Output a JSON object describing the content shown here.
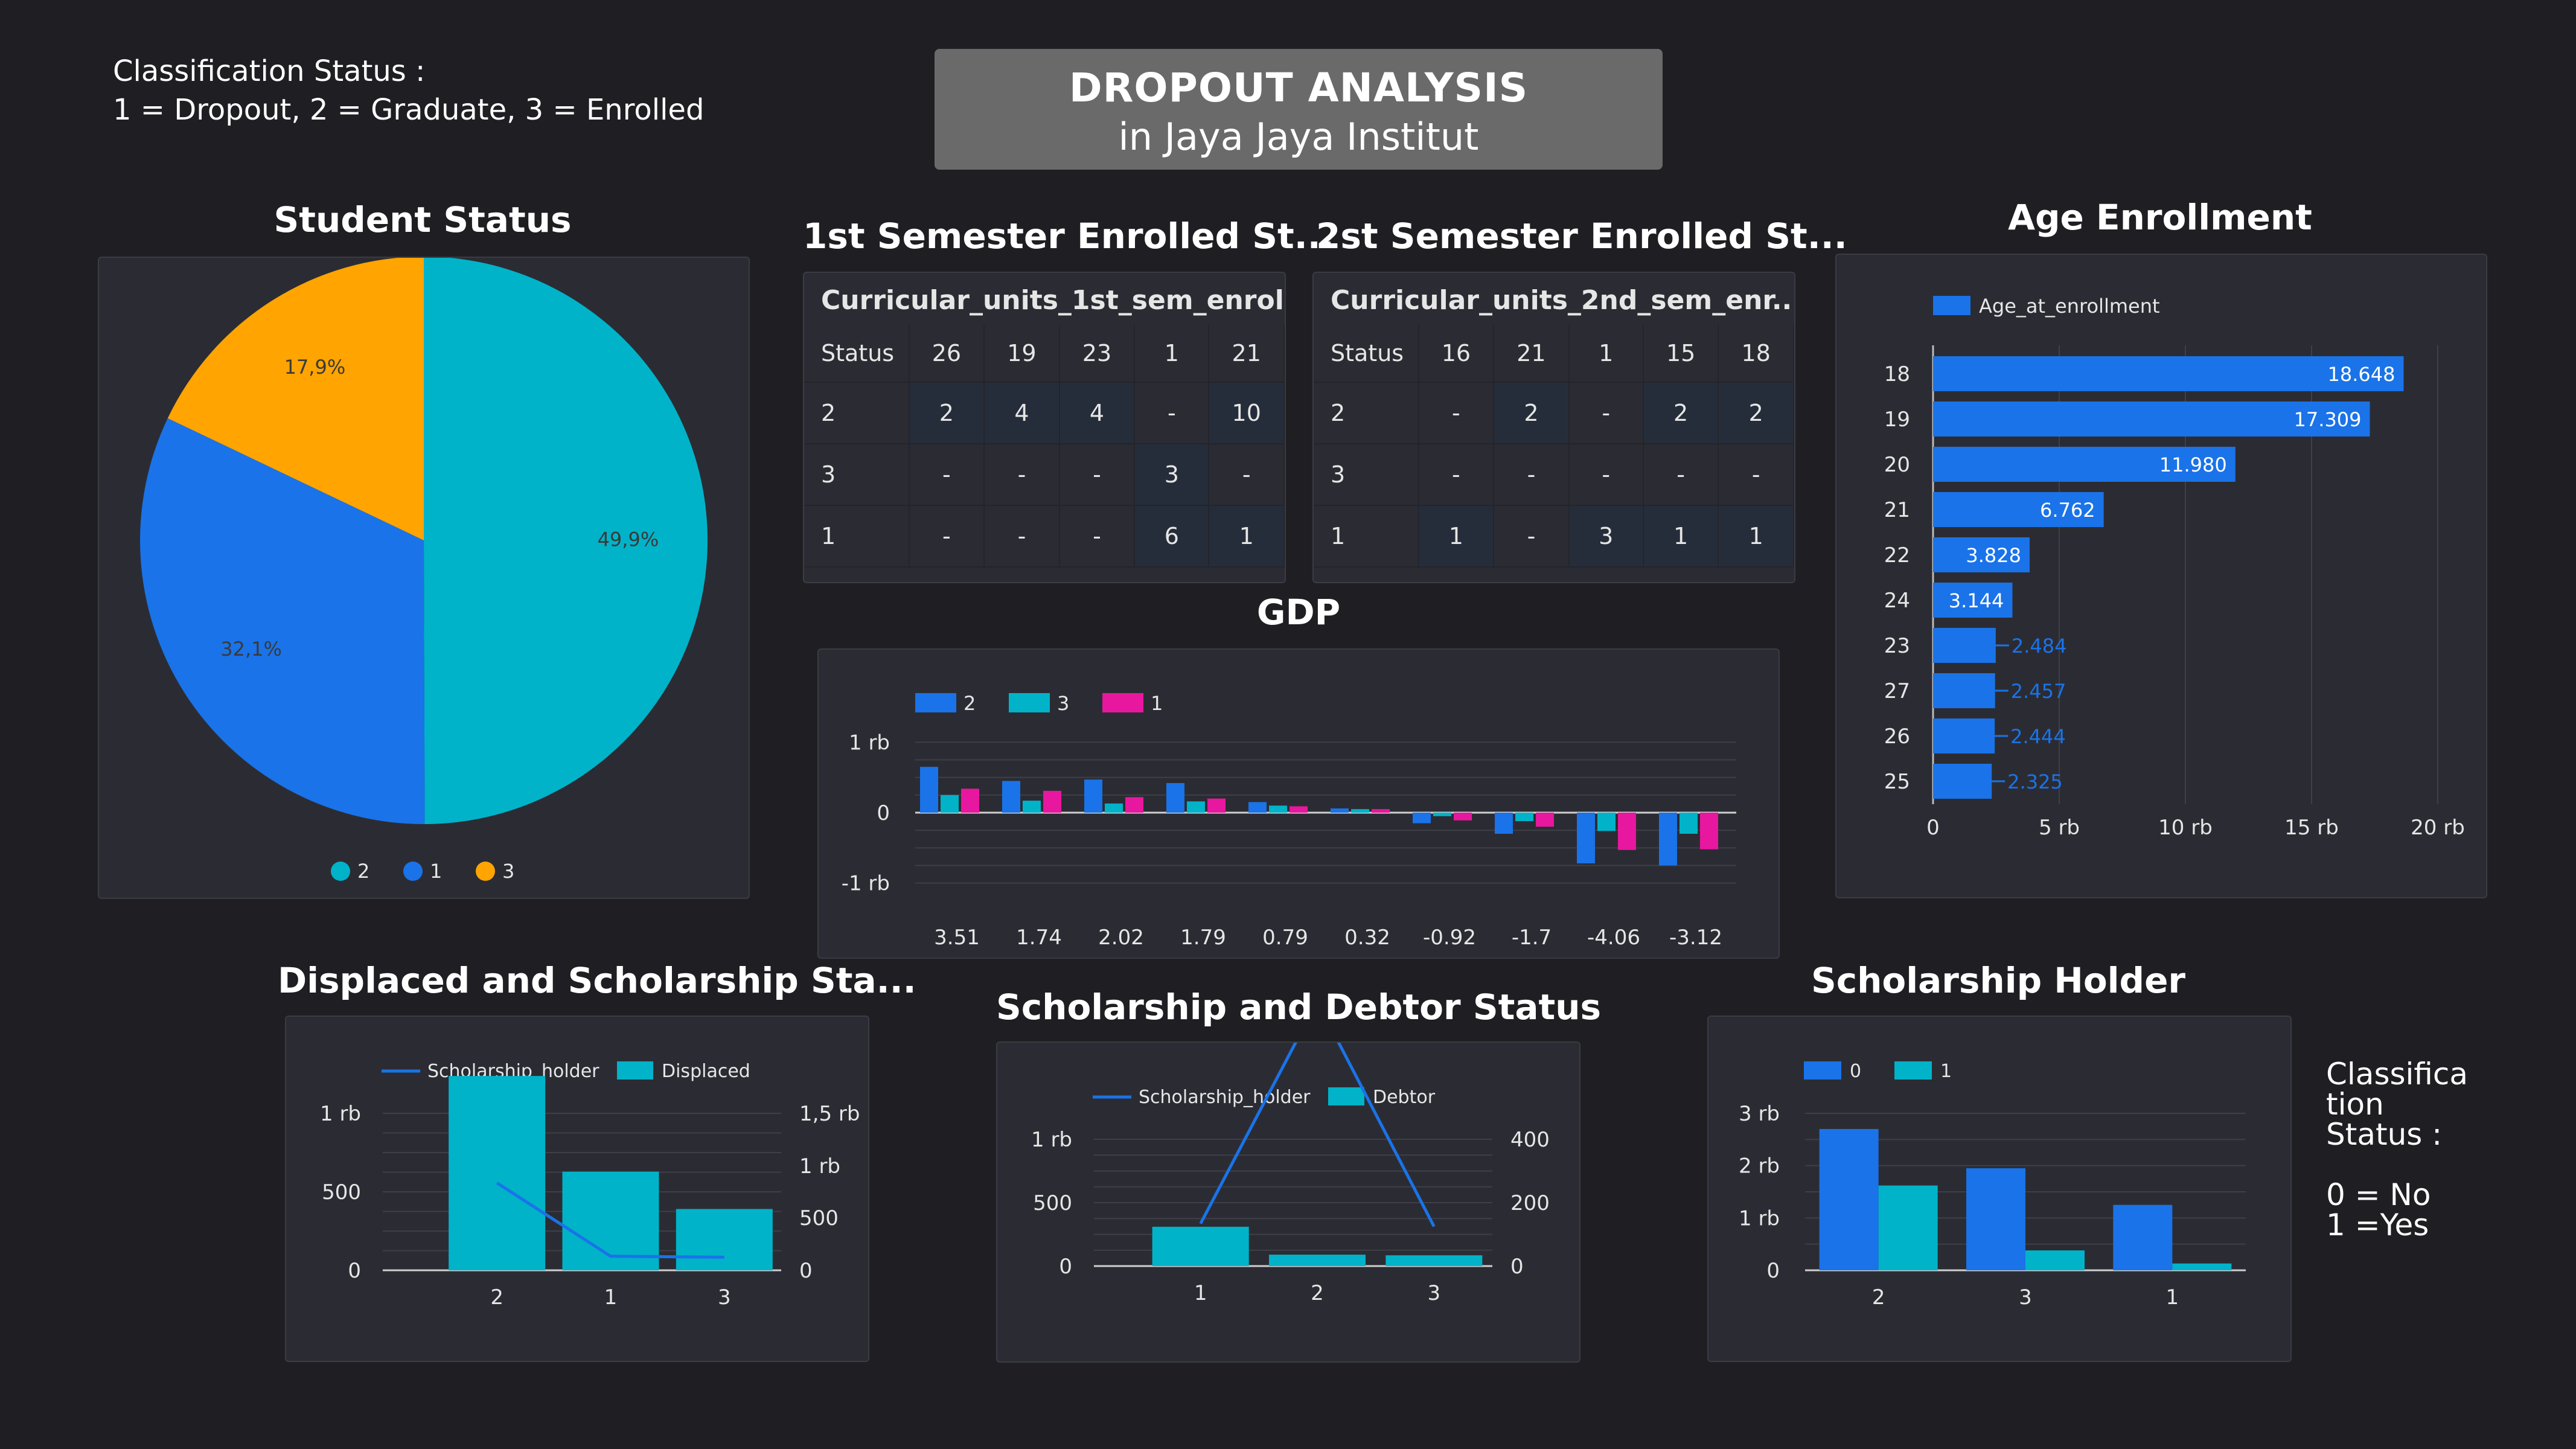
{
  "header": {
    "title": "DROPOUT ANALYSIS",
    "subtitle": "in Jaya Jaya Institut"
  },
  "notes": {
    "classification_top": "Classification Status :\n1 = Dropout, 2 = Graduate, 3 = Enrolled",
    "classification_right": "Classifica\ntion\nStatus :\n\n0 = No\n1 =Yes"
  },
  "titles": {
    "student_status": "Student Status",
    "sem1": "1st Semester Enrolled St...",
    "sem2": "2st Semester Enrolled St...",
    "age": "Age Enrollment",
    "gdp": "GDP",
    "displaced": "Displaced and Scholarship Sta...",
    "debtor": "Scholarship and Debtor Status",
    "holder": "Scholarship Holder"
  },
  "colors": {
    "blue": "#1a73e8",
    "cyan": "#00b3c9",
    "orange": "#ffa400",
    "pink": "#e8179f",
    "bg": "#1f1e22",
    "panel": "#2b2c33"
  },
  "chart_data": [
    {
      "id": "student_status",
      "type": "pie",
      "slices": [
        {
          "name": "2",
          "value": 49.9,
          "label": "49,9%",
          "color": "#00b3c9"
        },
        {
          "name": "1",
          "value": 32.1,
          "label": "32,1%",
          "color": "#1a73e8"
        },
        {
          "name": "3",
          "value": 17.9,
          "label": "17,9%",
          "color": "#ffa400"
        }
      ],
      "legend": [
        "2",
        "1",
        "3"
      ]
    },
    {
      "id": "sem1",
      "type": "table",
      "header_title": "Curricular_units_1st_sem_enrol...",
      "columns": [
        "Status",
        "26",
        "19",
        "23",
        "1",
        "21"
      ],
      "rows": [
        [
          "2",
          "2",
          "4",
          "4",
          "-",
          "10"
        ],
        [
          "3",
          "-",
          "-",
          "-",
          "3",
          "-"
        ],
        [
          "1",
          "-",
          "-",
          "-",
          "6",
          "1"
        ]
      ]
    },
    {
      "id": "sem2",
      "type": "table",
      "header_title": "Curricular_units_2nd_sem_enr...",
      "columns": [
        "Status",
        "16",
        "21",
        "1",
        "15",
        "18"
      ],
      "rows": [
        [
          "2",
          "-",
          "2",
          "-",
          "2",
          "2"
        ],
        [
          "3",
          "-",
          "-",
          "-",
          "-",
          "-"
        ],
        [
          "1",
          "1",
          "-",
          "3",
          "1",
          "1"
        ]
      ]
    },
    {
      "id": "age",
      "type": "bar",
      "orientation": "horizontal",
      "legend": "Age_at_enrollment",
      "categories": [
        "18",
        "19",
        "20",
        "21",
        "22",
        "24",
        "23",
        "27",
        "26",
        "25"
      ],
      "values": [
        18648,
        17309,
        11980,
        6762,
        3828,
        3144,
        2484,
        2457,
        2444,
        2325
      ],
      "value_labels": [
        "18.648",
        "17.309",
        "11.980",
        "6.762",
        "3.828",
        "3.144",
        "2.484",
        "2.457",
        "2.444",
        "2.325"
      ],
      "xticks": [
        "0",
        "5 rb",
        "10 rb",
        "15 rb",
        "20 rb"
      ],
      "xlim": [
        0,
        20000
      ]
    },
    {
      "id": "gdp",
      "type": "bar",
      "categories": [
        "3.51",
        "1.74",
        "2.02",
        "1.79",
        "0.79",
        "0.32",
        "-0.92",
        "-1.7",
        "-4.06",
        "-3.12"
      ],
      "series": [
        {
          "name": "2",
          "color": "#1a73e8",
          "values": [
            650,
            450,
            470,
            420,
            150,
            60,
            -150,
            -300,
            -720,
            -750
          ]
        },
        {
          "name": "3",
          "color": "#00b3c9",
          "values": [
            250,
            170,
            130,
            160,
            100,
            50,
            -50,
            -120,
            -260,
            -300
          ]
        },
        {
          "name": "1",
          "color": "#e8179f",
          "values": [
            340,
            310,
            220,
            200,
            90,
            50,
            -110,
            -200,
            -530,
            -520
          ]
        }
      ],
      "yticks": [
        "1 rb",
        "0",
        "-1 rb"
      ],
      "ylim": [
        -1200,
        1200
      ]
    },
    {
      "id": "displaced",
      "type": "bar",
      "categories": [
        "2",
        "1",
        "3"
      ],
      "series": [
        {
          "name": "Displaced",
          "kind": "bar",
          "color": "#00b3c9",
          "values": [
            1300,
            660,
            410
          ]
        },
        {
          "name": "Scholarship_holder",
          "kind": "line",
          "color": "#1a73e8",
          "values": [
            835,
            134,
            125
          ]
        }
      ],
      "yticks_left": [
        "1 rb",
        "500",
        "0"
      ],
      "yticks_right": [
        "1,5 rb",
        "1 rb",
        "500",
        "0"
      ],
      "ylim_left": [
        0,
        1050
      ],
      "ylim_right": [
        0,
        1500
      ]
    },
    {
      "id": "debtor",
      "type": "bar",
      "categories": [
        "1",
        "2",
        "3"
      ],
      "series": [
        {
          "name": "Debtor",
          "kind": "bar",
          "color": "#00b3c9",
          "values": [
            310,
            90,
            85
          ]
        },
        {
          "name": "Scholarship_holder",
          "kind": "line",
          "color": "#1a73e8",
          "values": [
            134,
            835,
            125
          ]
        }
      ],
      "yticks_left": [
        "1 rb",
        "500",
        "0"
      ],
      "yticks_right": [
        "400",
        "200",
        "0"
      ],
      "ylim_left": [
        0,
        1000
      ],
      "ylim_right": [
        0,
        400
      ]
    },
    {
      "id": "holder",
      "type": "bar",
      "categories": [
        "2",
        "3",
        "1"
      ],
      "series": [
        {
          "name": "0",
          "color": "#1a73e8",
          "values": [
            2700,
            1950,
            1250
          ]
        },
        {
          "name": "1",
          "color": "#00b3c9",
          "values": [
            1620,
            380,
            130
          ]
        }
      ],
      "yticks": [
        "3 rb",
        "2 rb",
        "1 rb",
        "0"
      ],
      "ylim": [
        0,
        3000
      ]
    }
  ]
}
